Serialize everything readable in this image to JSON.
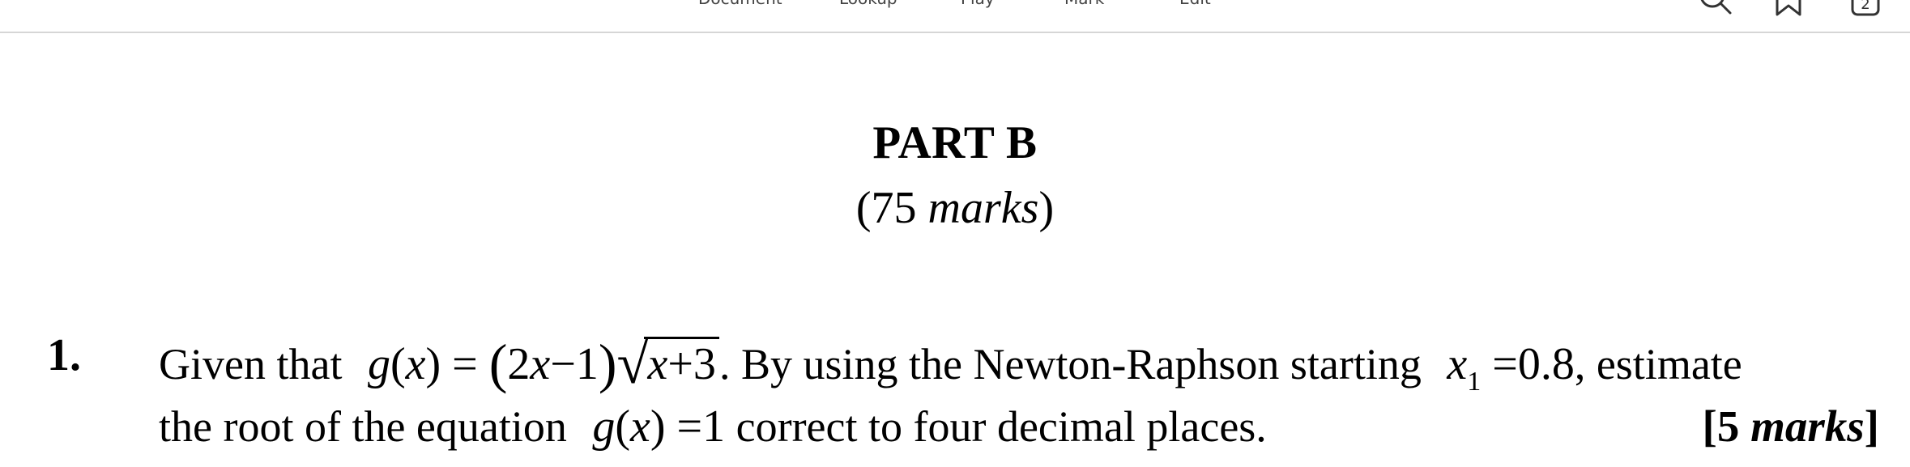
{
  "toolbar": {
    "tabs": [
      "Document",
      "Lookup",
      "Play",
      "Mark",
      "Edit"
    ],
    "icons": [
      "search-icon",
      "bookmark-icon",
      "page-count-icon"
    ],
    "page_count": "2"
  },
  "doc": {
    "part_title": "PART B",
    "total_marks": {
      "open": "(75 ",
      "word": "marks",
      "close": ")"
    },
    "question": {
      "number": "1.",
      "text_a": "Given that ",
      "g_label": "g",
      "x_var": "x",
      "eq": "=",
      "factor_a": "2",
      "minus_one": "−1",
      "sqrt_x": "x",
      "sqrt_rest": "+3",
      "text_b": ". By using the Newton-Raphson starting ",
      "x1_var": "x",
      "x1_sub": "1",
      "x1_value": "=0.8",
      "text_c": ", estimate",
      "text_d": "the root of the equation ",
      "eq2_rhs": "=1",
      "text_e": " correct to four decimal places.",
      "mark_open": "[5 ",
      "mark_word": "marks",
      "mark_close": "]"
    }
  }
}
